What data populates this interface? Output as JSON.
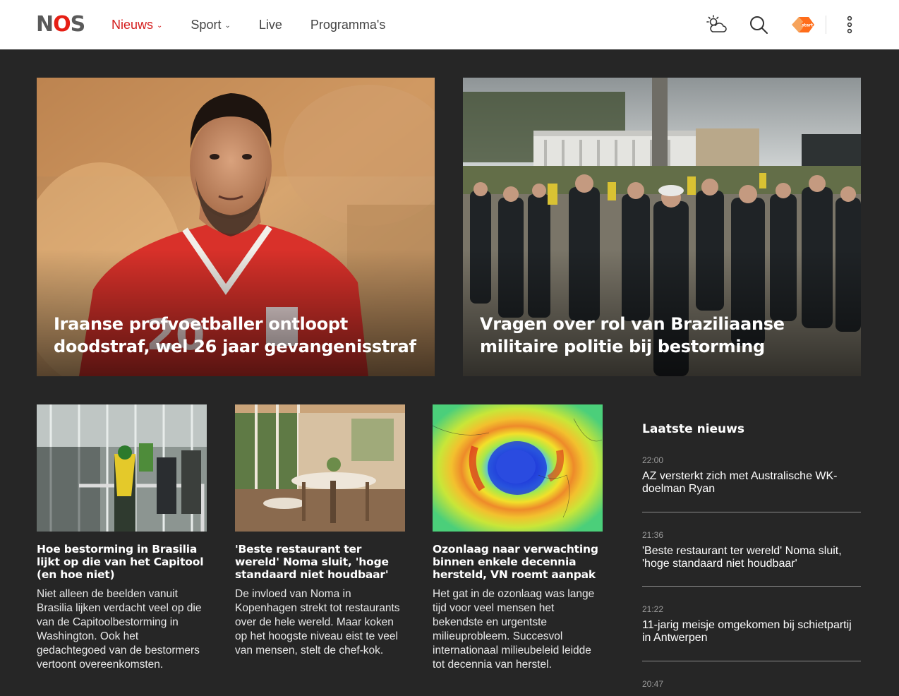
{
  "header": {
    "logo_n": "N",
    "logo_o": "O",
    "logo_s": "S",
    "nav": [
      {
        "label": "Nieuws",
        "chevron": "⌄",
        "active": true
      },
      {
        "label": "Sport",
        "chevron": "⌄",
        "active": false
      },
      {
        "label": "Live",
        "chevron": "",
        "active": false
      },
      {
        "label": "Programma's",
        "chevron": "",
        "active": false
      }
    ],
    "icons": [
      "weather-icon",
      "search-icon",
      "npo-start-icon",
      "more-vertical-icon"
    ],
    "npo_label": "start"
  },
  "hero": [
    {
      "title": "Iraanse profvoetballer ontloopt doodstraf, wel 26 jaar gevangenisstraf"
    },
    {
      "title": "Vragen over rol van Braziliaanse militaire politie bij bestorming"
    }
  ],
  "cards": [
    {
      "title": "Hoe bestorming in Brasilia lijkt op die van het Capitool (en hoe niet)",
      "text": "Niet alleen de beelden vanuit Brasilia lijken verdacht veel op die van de Capitoolbestorming in Washington. Ook het gedachtegoed van de bestormers vertoont overeenkomsten."
    },
    {
      "title": "'Beste restaurant ter wereld' Noma sluit, 'hoge standaard niet houdbaar'",
      "text": "De invloed van Noma in Kopenhagen strekt tot restaurants over de hele wereld. Maar koken op het hoogste niveau eist te veel van mensen, stelt de chef-kok."
    },
    {
      "title": "Ozonlaag naar verwachting binnen enkele decennia hersteld, VN roemt aanpak",
      "text": "Het gat in de ozonlaag was lange tijd voor veel mensen het bekendste en urgentste milieuprobleem. Succesvol internationaal milieubeleid leidde tot decennia van herstel."
    }
  ],
  "latest": {
    "title": "Laatste nieuws",
    "items": [
      {
        "time": "22:00",
        "text": "AZ versterkt zich met Australische WK-doelman Ryan"
      },
      {
        "time": "21:36",
        "text": "'Beste restaurant ter wereld' Noma sluit, 'hoge standaard niet houdbaar'"
      },
      {
        "time": "21:22",
        "text": "11-jarig meisje omgekomen bij schietpartij in Antwerpen"
      },
      {
        "time": "20:47",
        "text": ""
      }
    ]
  },
  "colors": {
    "accent": "#d41c1c",
    "logo_gray": "#5a5a5a",
    "background": "#262626"
  }
}
